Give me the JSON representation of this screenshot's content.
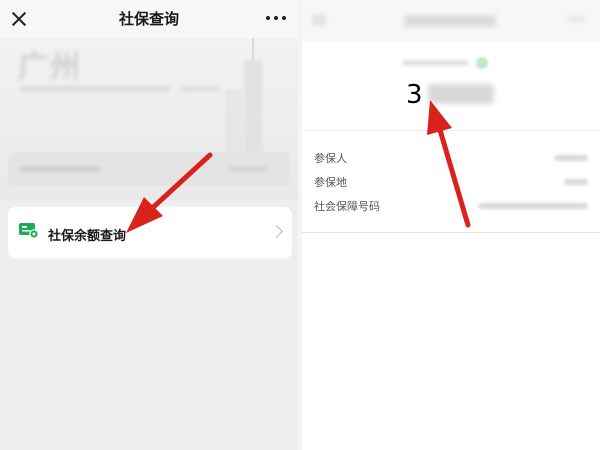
{
  "left_screen": {
    "header": {
      "title": "社保查询"
    },
    "hero": {
      "city_text": "广州"
    },
    "menu": {
      "label": "社保余额查询"
    }
  },
  "right_screen": {
    "amount_visible_digit": "3",
    "rows": [
      {
        "label": "参保人"
      },
      {
        "label": "参保地"
      },
      {
        "label": "社会保障号码"
      }
    ]
  },
  "colors": {
    "arrow": "#d9221c",
    "icon_green": "#1aad54"
  },
  "icons": [
    "close-icon",
    "more-icon",
    "card-icon",
    "chevron-right-icon"
  ]
}
